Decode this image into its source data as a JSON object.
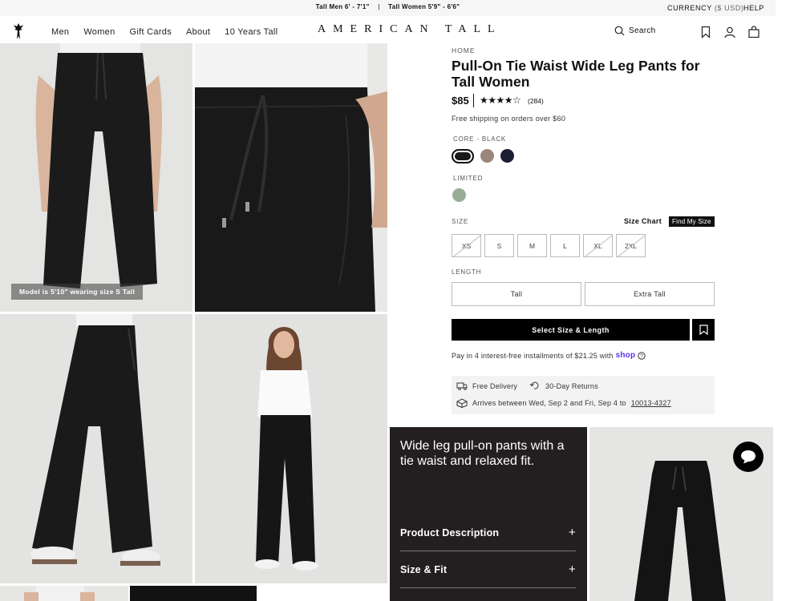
{
  "announcement": {
    "men_heights": "Tall Men 6' - 7'1\"",
    "divider": "|",
    "women_heights": "Tall Women 5'9\" - 6'6\"",
    "currency_label": "CURRENCY",
    "currency_value": "($ USD)",
    "help": "HELP"
  },
  "header": {
    "nav": [
      "Men",
      "Women",
      "Gift Cards",
      "About",
      "10 Years Tall"
    ],
    "brand": "AMERICAN TALL",
    "search_label": "Search"
  },
  "gallery": {
    "caption": "Model is 5'10\" wearing size S Tall"
  },
  "product": {
    "breadcrumb": "HOME",
    "title": "Pull-On Tie Waist Wide Leg Pants for Tall Women",
    "price": "$85",
    "stars": "★★★★☆",
    "rating": 4.5,
    "review_count": "(284)",
    "shipping": "Free shipping on orders over $60",
    "core_label": "CORE - BLACK",
    "core_swatches": [
      {
        "name": "Black",
        "color": "#1a1a1a"
      },
      {
        "name": "Mocha",
        "color": "#9c857b"
      },
      {
        "name": "Navy",
        "color": "#1c1f33"
      }
    ],
    "limited_label": "LIMITED",
    "limited_swatches": [
      {
        "name": "Sage",
        "color": "#97ad97"
      }
    ],
    "size_label": "SIZE",
    "size_chart": "Size Chart",
    "find_my_size": "Find My Size",
    "sizes": [
      {
        "label": "XS",
        "available": false
      },
      {
        "label": "S",
        "available": true
      },
      {
        "label": "M",
        "available": true
      },
      {
        "label": "L",
        "available": true
      },
      {
        "label": "XL",
        "available": false
      },
      {
        "label": "2XL",
        "available": false
      }
    ],
    "length_label": "LENGTH",
    "lengths": [
      "Tall",
      "Extra Tall"
    ],
    "cta": "Select Size & Length",
    "pay_text": "Pay in 4 interest-free installments of $21.25 with",
    "pay_brand": "shop",
    "free_delivery": "Free Delivery",
    "returns": "30-Day Returns",
    "arrives_text": "Arrives between Wed, Sep 2 and Fri, Sep 4 to",
    "zip": "10013-4327"
  },
  "description": {
    "tagline": "Wide leg pull-on pants with a tie waist and relaxed fit.",
    "sections": [
      "Product Description",
      "Size & Fit"
    ]
  },
  "colors": {
    "accent": "#000000",
    "panel": "#231f20",
    "shop_purple": "#5a31f4"
  }
}
